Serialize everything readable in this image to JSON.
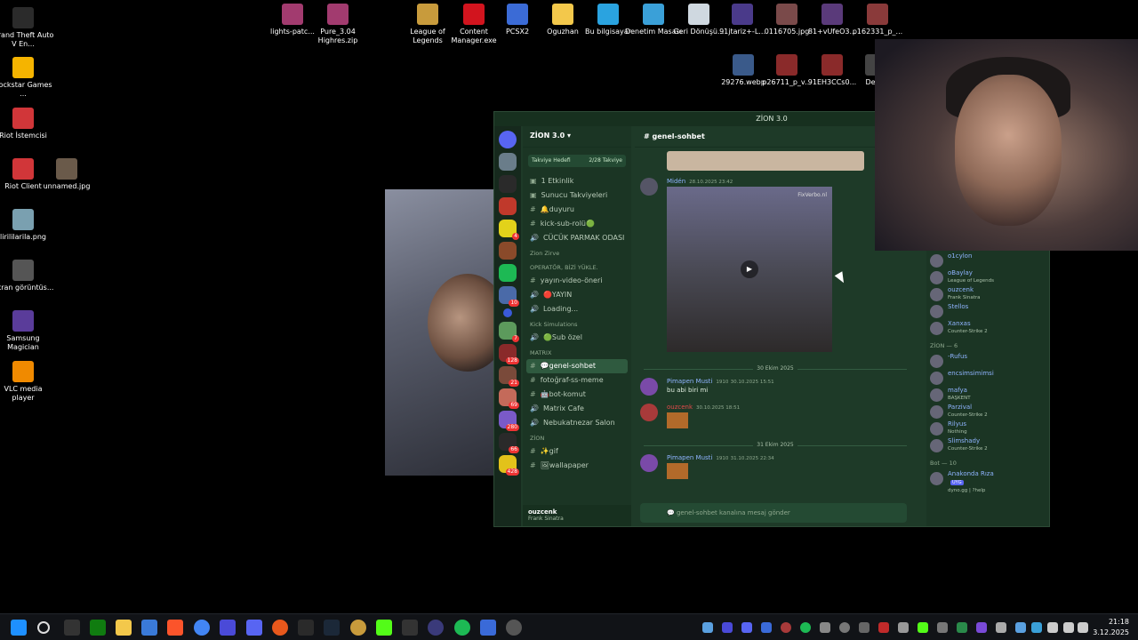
{
  "desktop": {
    "icons_left": [
      {
        "label": "Grand Theft Auto V En...",
        "icon": "gta-icon",
        "color": "#2b2b2b"
      },
      {
        "label": "Rockstar Games ...",
        "icon": "rockstar-icon",
        "color": "#f5b400"
      },
      {
        "label": "Riot İstemcisi",
        "icon": "riot-icon",
        "color": "#d13639"
      },
      {
        "label": "Riot Client",
        "icon": "riot-client-icon",
        "color": "#d13639"
      },
      {
        "label": "unnamed.jpg",
        "icon": "image-icon",
        "color": "#6a5a4a"
      },
      {
        "label": "lirililarila.png",
        "icon": "image-icon",
        "color": "#7aa0b0"
      },
      {
        "label": "Ekran görüntüs...",
        "icon": "image-icon",
        "color": "#555"
      },
      {
        "label": "Samsung Magician",
        "icon": "samsung-magician-icon",
        "color": "#5a3c9a"
      },
      {
        "label": "VLC media player",
        "icon": "vlc-icon",
        "color": "#f08a00"
      }
    ],
    "icons_top": [
      {
        "label": "lights-patc...",
        "icon": "winrar-icon",
        "color": "#a23b6f"
      },
      {
        "label": "Pure_3.04 Highres.zip",
        "icon": "winrar-icon",
        "color": "#a23b6f"
      },
      {
        "label": "League of Legends",
        "icon": "lol-icon",
        "color": "#c89b3c"
      },
      {
        "label": "Content Manager.exe",
        "icon": "content-manager-icon",
        "color": "#d2141e"
      },
      {
        "label": "PCSX2",
        "icon": "pcsx2-icon",
        "color": "#3b6bd6"
      },
      {
        "label": "Oguzhan",
        "icon": "folder-icon",
        "color": "#f3c84b"
      },
      {
        "label": "Bu bilgisayar",
        "icon": "computer-icon",
        "color": "#2aa3e0"
      },
      {
        "label": "Denetim Masası",
        "icon": "control-panel-icon",
        "color": "#3aa0d8"
      },
      {
        "label": "Geri Dönüşü...",
        "icon": "recycle-bin-icon",
        "color": "#cfd8e0"
      },
      {
        "label": "91jtariz+-L...",
        "icon": "image-icon",
        "color": "#4a3a8a"
      },
      {
        "label": "0116705.jpg",
        "icon": "image-icon",
        "color": "#7a4a4a"
      },
      {
        "label": "81+vUfeO3...",
        "icon": "image-icon",
        "color": "#5a3a7a"
      },
      {
        "label": "p162331_p_...",
        "icon": "image-icon",
        "color": "#8a3a3a"
      },
      {
        "label": "29276.webp",
        "icon": "image-icon",
        "color": "#3a5a8a"
      },
      {
        "label": "p26711_p_v...",
        "icon": "image-icon",
        "color": "#8a2a2a"
      },
      {
        "label": "91EH3CCs0...",
        "icon": "image-icon",
        "color": "#8a2a2a"
      },
      {
        "label": "Der_F",
        "icon": "image-icon",
        "color": "#444"
      }
    ]
  },
  "discord": {
    "window_title": "ZİON 3.0",
    "guild_name": "ZİON 3.0",
    "boost_label": "Takviye Hedefi",
    "boost_progress": "2/28 Takviye",
    "channels": [
      {
        "kind": "event",
        "label": "1 Etkinlik"
      },
      {
        "kind": "event",
        "label": "Sunucu Takviyeleri"
      },
      {
        "kind": "text",
        "label": "🔔duyuru"
      },
      {
        "kind": "text",
        "label": "kick-sub-rolü🟢"
      },
      {
        "kind": "voice",
        "label": "CÜCÜK PARMAK ODASI"
      },
      {
        "kind": "cat",
        "label": "Zion Zirve"
      },
      {
        "kind": "cat",
        "label": "OPERATÖR, BİZİ YÜKLE."
      },
      {
        "kind": "text",
        "label": "yayın-video-öneri"
      },
      {
        "kind": "voice",
        "label": "🔴YAYIN"
      },
      {
        "kind": "voice",
        "label": "Loading..."
      },
      {
        "kind": "cat",
        "label": "Kick Simulations"
      },
      {
        "kind": "voice",
        "label": "🟢Sub özel"
      },
      {
        "kind": "cat",
        "label": "MATRIX"
      },
      {
        "kind": "active",
        "label": "💬genel-sohbet"
      },
      {
        "kind": "text",
        "label": "fotoğraf-ss-meme"
      },
      {
        "kind": "text",
        "label": "🤖bot-komut"
      },
      {
        "kind": "voice",
        "label": "Matrix Cafe"
      },
      {
        "kind": "voice",
        "label": "Nebukatnezar Salon"
      },
      {
        "kind": "cat",
        "label": "ZİON"
      },
      {
        "kind": "text",
        "label": "✨gif"
      },
      {
        "kind": "text",
        "label": "🖼wallapaper"
      }
    ],
    "user": {
      "name": "ouzcenk",
      "status": "Frank Sinatra"
    },
    "chat": {
      "channel_name": "genel-sohbet",
      "messages": [
        {
          "author": "Midén",
          "time": "28.10.2025 23:42",
          "text": "",
          "media_watermark": "FixVerbo.nl"
        },
        {
          "author": "Pimapen Musti",
          "badge": "1910",
          "time": "30.10.2025 15:51",
          "text": "bu abi biri mi"
        },
        {
          "author": "ouzcenk",
          "time": "30.10.2025 18:51",
          "text": ""
        },
        {
          "author": "Pimapen Musti",
          "badge": "1910",
          "time": "31.10.2025 22:34",
          "text": ""
        }
      ],
      "separators": [
        "30 Ekim 2025",
        "31 Ekim 2025"
      ],
      "composer_placeholder": "💬 genel-sohbet kanalına mesaj gönder"
    },
    "members": {
      "online": [
        {
          "name": "o1cylon",
          "status": ""
        },
        {
          "name": "oBaylay",
          "status": "League of Legends"
        },
        {
          "name": "ouzcenk",
          "status": "Frank Sinatra"
        },
        {
          "name": "Stellos",
          "status": ""
        },
        {
          "name": "Xanxas",
          "status": "Counter-Strike 2"
        }
      ],
      "zion_header": "ZİON — 6",
      "zion": [
        {
          "name": "-Rufus",
          "status": ""
        },
        {
          "name": "encsimsimimsi",
          "status": ""
        },
        {
          "name": "mafya",
          "status": "BAŞKENT"
        },
        {
          "name": "Parzival",
          "status": "Counter-Strike 2"
        },
        {
          "name": "Rilyus",
          "status": "Nothing"
        },
        {
          "name": "Slimshady",
          "status": "Counter-Strike 2"
        }
      ],
      "bot_header": "Bot — 10",
      "bots": [
        {
          "name": "Anakonda Rıza",
          "tag": "UYG",
          "status": "dyno.gg | ?help"
        }
      ]
    }
  },
  "taskbar": {
    "time": "21:18",
    "date": "3.12.2025"
  }
}
